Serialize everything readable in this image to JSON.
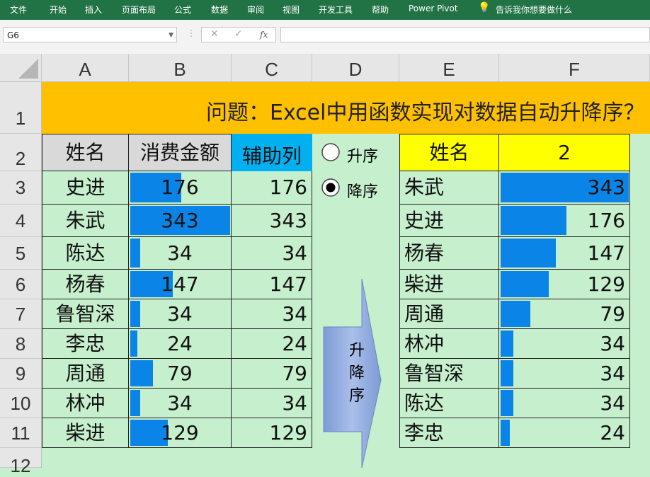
{
  "ribbon": {
    "tabs": [
      "文件",
      "开始",
      "插入",
      "页面布局",
      "公式",
      "数据",
      "审阅",
      "视图",
      "开发工具",
      "帮助",
      "Power Pivot"
    ],
    "tell_me": "告诉我你想要做什么"
  },
  "formula_bar": {
    "name_box": "G6",
    "cancel": "✕",
    "enter": "✓",
    "fx": "fx",
    "formula": ""
  },
  "columns": [
    "A",
    "B",
    "C",
    "D",
    "E",
    "F"
  ],
  "rows": [
    "1",
    "2",
    "3",
    "4",
    "5",
    "6",
    "7",
    "8",
    "9",
    "10",
    "11",
    "12"
  ],
  "title": "问题：Excel中用函数实现对数据自动升降序？",
  "source": {
    "headers": {
      "name": "姓名",
      "amount": "消费金额",
      "helper": "辅助列"
    },
    "max": 343,
    "rows": [
      {
        "name": "史进",
        "amount": 176,
        "helper": 176
      },
      {
        "name": "朱武",
        "amount": 343,
        "helper": 343
      },
      {
        "name": "陈达",
        "amount": 34,
        "helper": 34
      },
      {
        "name": "杨春",
        "amount": 147,
        "helper": 147
      },
      {
        "name": "鲁智深",
        "amount": 34,
        "helper": 34
      },
      {
        "name": "李忠",
        "amount": 24,
        "helper": 24
      },
      {
        "name": "周通",
        "amount": 79,
        "helper": 79
      },
      {
        "name": "林冲",
        "amount": 34,
        "helper": 34
      },
      {
        "name": "柴进",
        "amount": 129,
        "helper": 129
      }
    ]
  },
  "options": {
    "ascending": "升序",
    "descending": "降序",
    "selected": "descending"
  },
  "arrow_label": [
    "升",
    "降",
    "序"
  ],
  "sorted": {
    "header_name": "姓名",
    "header_value": "2",
    "max": 343,
    "rows": [
      {
        "name": "朱武",
        "value": 343
      },
      {
        "name": "史进",
        "value": 176
      },
      {
        "name": "杨春",
        "value": 147
      },
      {
        "name": "柴进",
        "value": 129
      },
      {
        "name": "周通",
        "value": 79
      },
      {
        "name": "林冲",
        "value": 34
      },
      {
        "name": "鲁智深",
        "value": 34
      },
      {
        "name": "陈达",
        "value": 34
      },
      {
        "name": "李忠",
        "value": 24
      }
    ]
  },
  "colors": {
    "ribbon": "#217346",
    "sheet_bg": "#c6efce",
    "title_bg": "#ffc000",
    "header_grey": "#d9d9d9",
    "helper_bg": "#00b0f0",
    "yellow": "#ffff00",
    "bar": "#0a84e6",
    "arrow": "#8fa9dc"
  }
}
